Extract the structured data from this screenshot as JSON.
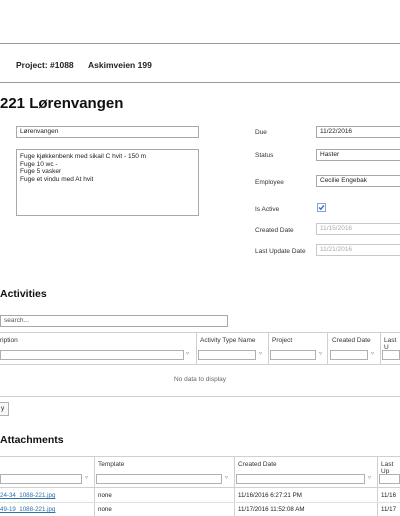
{
  "project": {
    "number_label": "Project: #1088",
    "address": "Askimveien 199"
  },
  "page_title": "221 Lørenvangen",
  "form": {
    "name_value": "Lørenvangen",
    "notes_lines": [
      "Fuge kjøkkenbenk med sikail C hvit - 150 m",
      "Fuge 10 wc -",
      "Fuge 5 vasker",
      "Fuge et vindu med At hvit"
    ],
    "due_label": "Due",
    "due_value": "11/22/2016",
    "status_label": "Status",
    "status_value": "Haster",
    "employee_label": "Employee",
    "employee_value": "Cecilie Engebak",
    "is_active_label": "Is Active",
    "is_active_checked": true,
    "created_label": "Created Date",
    "created_value": "11/15/2016",
    "updated_label": "Last Update Date",
    "updated_value": "11/21/2016"
  },
  "activities": {
    "heading": "Activities",
    "search_placeholder": "search...",
    "columns": [
      "ription",
      "Activity Type Name",
      "Project",
      "Created Date",
      "Last U"
    ],
    "empty_text": "No data to display",
    "button_label": "y"
  },
  "attachments": {
    "heading": "Attachments",
    "columns": [
      "Template",
      "Created Date",
      "Last Up"
    ],
    "rows": [
      {
        "file": "24-34_1088-221.jpg",
        "template": "none",
        "created": "11/16/2016 6:27:21 PM",
        "last": "11/16"
      },
      {
        "file": "49-19_1088-221.jpg",
        "template": "none",
        "created": "11/17/2016 11:52:08 AM",
        "last": "11/17"
      }
    ]
  },
  "colors": {
    "link": "#2a6fb0",
    "checkbox": "#2b6cd6"
  },
  "icons": [
    "funnel-icon",
    "checkmark-icon"
  ]
}
